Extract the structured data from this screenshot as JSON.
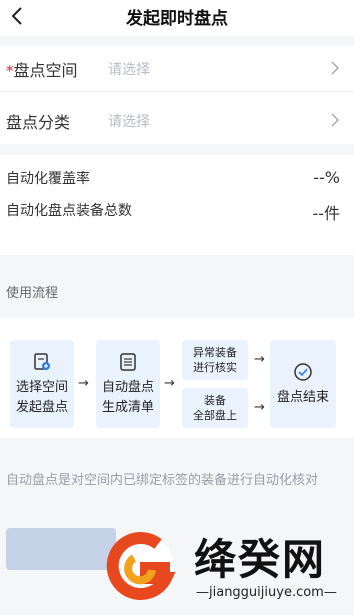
{
  "header": {
    "title": "发起即时盘点",
    "back_icon": "chevron-left-icon"
  },
  "form": {
    "space": {
      "required_mark": "*",
      "label": "盘点空间",
      "placeholder": "请选择"
    },
    "category": {
      "label": "盘点分类",
      "placeholder": "请选择"
    }
  },
  "stats": {
    "coverage_label": "自动化覆盖率",
    "coverage_value": "--%",
    "total_label": "自动化盘点装备总数",
    "total_value": "--件"
  },
  "usage": {
    "title": "使用流程",
    "steps": [
      {
        "label_1": "选择空间",
        "label_2": "发起盘点",
        "icon": "doc-add-icon"
      },
      {
        "label_1": "自动盘点",
        "label_2": "生成清单",
        "icon": "checklist-icon"
      },
      {
        "label_1": "异常装备",
        "label_2": "进行核实"
      },
      {
        "label_1": "装备",
        "label_2": "全部盘上"
      },
      {
        "label_1": "盘点结束",
        "icon": "check-circle-icon"
      }
    ],
    "arrow": "→"
  },
  "note": "自动盘点是对空间内已绑定标签的装备进行自动化核对",
  "watermark": {
    "brand": "绛癸网",
    "url": "—jiangguijiuye.com—"
  }
}
